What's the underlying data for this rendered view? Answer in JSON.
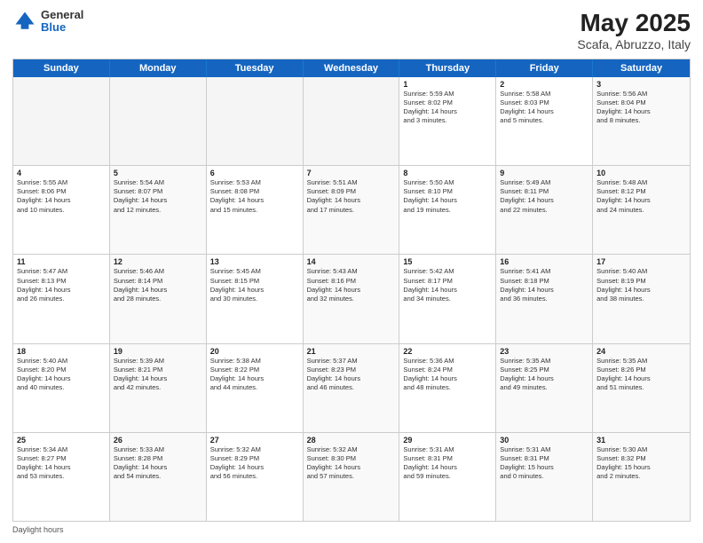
{
  "header": {
    "logo_general": "General",
    "logo_blue": "Blue",
    "title": "May 2025",
    "location": "Scafa, Abruzzo, Italy"
  },
  "days": [
    "Sunday",
    "Monday",
    "Tuesday",
    "Wednesday",
    "Thursday",
    "Friday",
    "Saturday"
  ],
  "weeks": [
    [
      {
        "day": "",
        "text": "",
        "empty": true
      },
      {
        "day": "",
        "text": "",
        "empty": true
      },
      {
        "day": "",
        "text": "",
        "empty": true
      },
      {
        "day": "",
        "text": "",
        "empty": true
      },
      {
        "day": "1",
        "text": "Sunrise: 5:59 AM\nSunset: 8:02 PM\nDaylight: 14 hours\nand 3 minutes."
      },
      {
        "day": "2",
        "text": "Sunrise: 5:58 AM\nSunset: 8:03 PM\nDaylight: 14 hours\nand 5 minutes."
      },
      {
        "day": "3",
        "text": "Sunrise: 5:56 AM\nSunset: 8:04 PM\nDaylight: 14 hours\nand 8 minutes.",
        "alt": true
      }
    ],
    [
      {
        "day": "4",
        "text": "Sunrise: 5:55 AM\nSunset: 8:06 PM\nDaylight: 14 hours\nand 10 minutes."
      },
      {
        "day": "5",
        "text": "Sunrise: 5:54 AM\nSunset: 8:07 PM\nDaylight: 14 hours\nand 12 minutes.",
        "alt": true
      },
      {
        "day": "6",
        "text": "Sunrise: 5:53 AM\nSunset: 8:08 PM\nDaylight: 14 hours\nand 15 minutes."
      },
      {
        "day": "7",
        "text": "Sunrise: 5:51 AM\nSunset: 8:09 PM\nDaylight: 14 hours\nand 17 minutes.",
        "alt": true
      },
      {
        "day": "8",
        "text": "Sunrise: 5:50 AM\nSunset: 8:10 PM\nDaylight: 14 hours\nand 19 minutes."
      },
      {
        "day": "9",
        "text": "Sunrise: 5:49 AM\nSunset: 8:11 PM\nDaylight: 14 hours\nand 22 minutes.",
        "alt": true
      },
      {
        "day": "10",
        "text": "Sunrise: 5:48 AM\nSunset: 8:12 PM\nDaylight: 14 hours\nand 24 minutes.",
        "alt": true
      }
    ],
    [
      {
        "day": "11",
        "text": "Sunrise: 5:47 AM\nSunset: 8:13 PM\nDaylight: 14 hours\nand 26 minutes."
      },
      {
        "day": "12",
        "text": "Sunrise: 5:46 AM\nSunset: 8:14 PM\nDaylight: 14 hours\nand 28 minutes.",
        "alt": true
      },
      {
        "day": "13",
        "text": "Sunrise: 5:45 AM\nSunset: 8:15 PM\nDaylight: 14 hours\nand 30 minutes."
      },
      {
        "day": "14",
        "text": "Sunrise: 5:43 AM\nSunset: 8:16 PM\nDaylight: 14 hours\nand 32 minutes.",
        "alt": true
      },
      {
        "day": "15",
        "text": "Sunrise: 5:42 AM\nSunset: 8:17 PM\nDaylight: 14 hours\nand 34 minutes."
      },
      {
        "day": "16",
        "text": "Sunrise: 5:41 AM\nSunset: 8:18 PM\nDaylight: 14 hours\nand 36 minutes.",
        "alt": true
      },
      {
        "day": "17",
        "text": "Sunrise: 5:40 AM\nSunset: 8:19 PM\nDaylight: 14 hours\nand 38 minutes.",
        "alt": true
      }
    ],
    [
      {
        "day": "18",
        "text": "Sunrise: 5:40 AM\nSunset: 8:20 PM\nDaylight: 14 hours\nand 40 minutes."
      },
      {
        "day": "19",
        "text": "Sunrise: 5:39 AM\nSunset: 8:21 PM\nDaylight: 14 hours\nand 42 minutes.",
        "alt": true
      },
      {
        "day": "20",
        "text": "Sunrise: 5:38 AM\nSunset: 8:22 PM\nDaylight: 14 hours\nand 44 minutes."
      },
      {
        "day": "21",
        "text": "Sunrise: 5:37 AM\nSunset: 8:23 PM\nDaylight: 14 hours\nand 46 minutes.",
        "alt": true
      },
      {
        "day": "22",
        "text": "Sunrise: 5:36 AM\nSunset: 8:24 PM\nDaylight: 14 hours\nand 48 minutes."
      },
      {
        "day": "23",
        "text": "Sunrise: 5:35 AM\nSunset: 8:25 PM\nDaylight: 14 hours\nand 49 minutes.",
        "alt": true
      },
      {
        "day": "24",
        "text": "Sunrise: 5:35 AM\nSunset: 8:26 PM\nDaylight: 14 hours\nand 51 minutes.",
        "alt": true
      }
    ],
    [
      {
        "day": "25",
        "text": "Sunrise: 5:34 AM\nSunset: 8:27 PM\nDaylight: 14 hours\nand 53 minutes."
      },
      {
        "day": "26",
        "text": "Sunrise: 5:33 AM\nSunset: 8:28 PM\nDaylight: 14 hours\nand 54 minutes.",
        "alt": true
      },
      {
        "day": "27",
        "text": "Sunrise: 5:32 AM\nSunset: 8:29 PM\nDaylight: 14 hours\nand 56 minutes."
      },
      {
        "day": "28",
        "text": "Sunrise: 5:32 AM\nSunset: 8:30 PM\nDaylight: 14 hours\nand 57 minutes.",
        "alt": true
      },
      {
        "day": "29",
        "text": "Sunrise: 5:31 AM\nSunset: 8:31 PM\nDaylight: 14 hours\nand 59 minutes."
      },
      {
        "day": "30",
        "text": "Sunrise: 5:31 AM\nSunset: 8:31 PM\nDaylight: 15 hours\nand 0 minutes.",
        "alt": true
      },
      {
        "day": "31",
        "text": "Sunrise: 5:30 AM\nSunset: 8:32 PM\nDaylight: 15 hours\nand 2 minutes.",
        "alt": true
      }
    ]
  ],
  "footer": "Daylight hours"
}
